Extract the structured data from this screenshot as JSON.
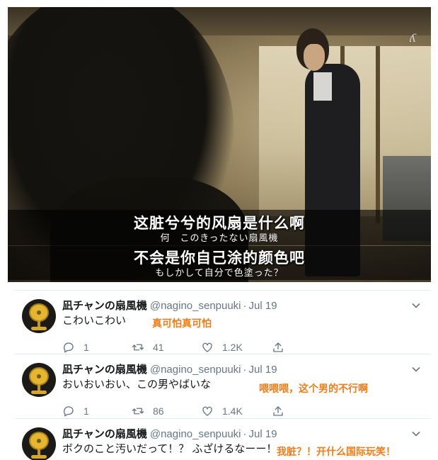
{
  "video": {
    "watermark": "ʎ",
    "subtitles": [
      {
        "cn": "这脏兮兮的风扇是什么啊",
        "jp": "何　このきったない扇風機"
      },
      {
        "cn": "不会是你自己涂的颜色吧",
        "jp": "もしかして自分で色塗った？"
      }
    ]
  },
  "tweets": [
    {
      "name": "凪チャンの扇風機",
      "handle": "@nagino_senpuuki",
      "separator": "·",
      "date": "Jul 19",
      "text": "こわいこわい",
      "annotation": "真可怕真可怕",
      "replies": "1",
      "retweets": "41",
      "likes": "1.2K"
    },
    {
      "name": "凪チャンの扇風機",
      "handle": "@nagino_senpuuki",
      "separator": "·",
      "date": "Jul 19",
      "text": "おいおいおい、この男やばいな",
      "annotation": "喂喂喂，这个男的不行啊",
      "replies": "1",
      "retweets": "86",
      "likes": "1.4K"
    },
    {
      "name": "凪チャンの扇風機",
      "handle": "@nagino_senpuuki",
      "separator": "·",
      "date": "Jul 19",
      "text": "ボクのこと汚いだって！？ ふざけるなーー！",
      "annotation": "我脏？！开什么国际玩笑！"
    }
  ],
  "icons": {
    "reply": "reply-icon",
    "retweet": "retweet-icon",
    "like": "heart-icon",
    "share": "share-icon",
    "caret": "chevron-down-icon"
  },
  "colors": {
    "annotation": "#ef7d1a",
    "secondary_text": "#657786",
    "primary_text": "#14171a",
    "divider": "#e1e8ed"
  }
}
